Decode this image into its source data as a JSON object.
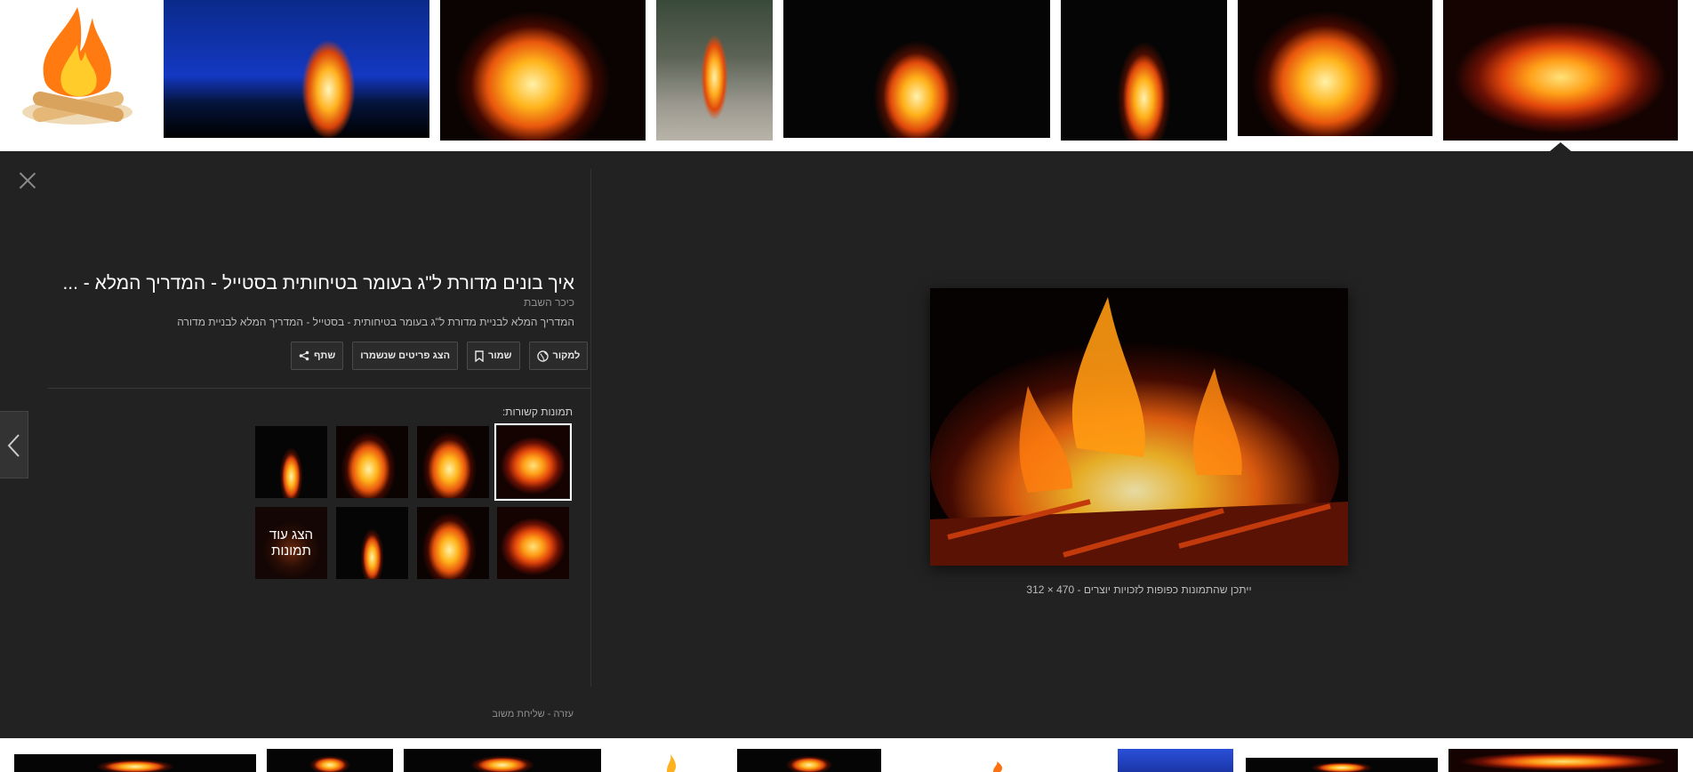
{
  "colors": {
    "panel_bg": "#222222",
    "title": "#ffffff",
    "muted": "#8e8e8e",
    "button_border": "#4a4a4a"
  },
  "top_strip": {
    "thumbnails": [
      {
        "name": "thumb-campfire-clipart",
        "style": "clipart"
      },
      {
        "name": "thumb-bonfire-blue-sky",
        "style": "fire-blue"
      },
      {
        "name": "thumb-fire-logs",
        "style": "fire-big"
      },
      {
        "name": "thumb-bonfire-grey",
        "style": "fire-grey"
      },
      {
        "name": "thumb-bonfire-night",
        "style": "fire-night"
      },
      {
        "name": "thumb-fire-night-small",
        "style": "fire-night"
      },
      {
        "name": "thumb-flames-branches",
        "style": "fire-big"
      },
      {
        "name": "thumb-fire-coals-selected",
        "style": "fire-coals"
      }
    ]
  },
  "panel": {
    "title": "איך בונים מדורת ל\"ג בעומר בטיחותית בסטייל - המדריך המלא - ...",
    "site": "כיכר השבת",
    "description": "המדריך המלא לבניית מדורת ל\"ג בעומר בטיחותית - בסטייל - המדריך המלא לבניית מדורה",
    "actions": {
      "visit": "למקור",
      "save": "שמור",
      "view_saved": "הצג פריטים שנשמרו",
      "share": "שתף"
    },
    "related_label": "תמונות קשורות:",
    "more_images": "הצג עוד תמונות",
    "footer": {
      "help": "עזרה",
      "separator": "-",
      "feedback": "שליחת משוב"
    },
    "caption": {
      "dimensions": "470 × 312",
      "separator": "-",
      "copyright": "ייתכן שהתמונות כפופות לזכויות יוצרים"
    }
  },
  "icons": [
    "close-icon",
    "chevron-left-icon",
    "globe-icon",
    "bookmark-icon",
    "share-icon"
  ]
}
